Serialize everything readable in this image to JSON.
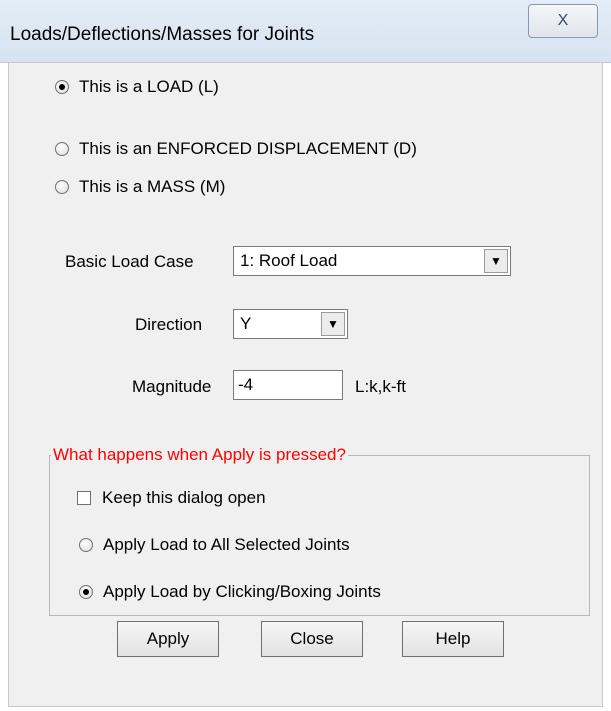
{
  "window": {
    "title": "Loads/Deflections/Masses for Joints",
    "close_glyph": "X"
  },
  "type_options": [
    {
      "label": "This is a LOAD (L)",
      "checked": true
    },
    {
      "label": "This is an ENFORCED DISPLACEMENT (D)",
      "checked": false
    },
    {
      "label": "This is a MASS (M)",
      "checked": false
    }
  ],
  "form": {
    "load_case_label": "Basic Load Case",
    "load_case_value": "1: Roof Load",
    "direction_label": "Direction",
    "direction_value": "Y",
    "magnitude_label": "Magnitude",
    "magnitude_value": "-4",
    "magnitude_units": "L:k,k-ft"
  },
  "apply_group": {
    "legend": "What happens when Apply is pressed?",
    "keep_open_label": "Keep this dialog open",
    "keep_open_checked": false,
    "options": [
      {
        "label": "Apply Load to All Selected Joints",
        "checked": false
      },
      {
        "label": "Apply Load by Clicking/Boxing Joints",
        "checked": true
      }
    ]
  },
  "buttons": {
    "apply": "Apply",
    "close": "Close",
    "help": "Help"
  },
  "icons": {
    "dropdown": "chevron-down-icon",
    "close": "close-icon"
  },
  "colors": {
    "legend_text": "#ff0000",
    "dialog_bg": "#f0f0f0"
  }
}
